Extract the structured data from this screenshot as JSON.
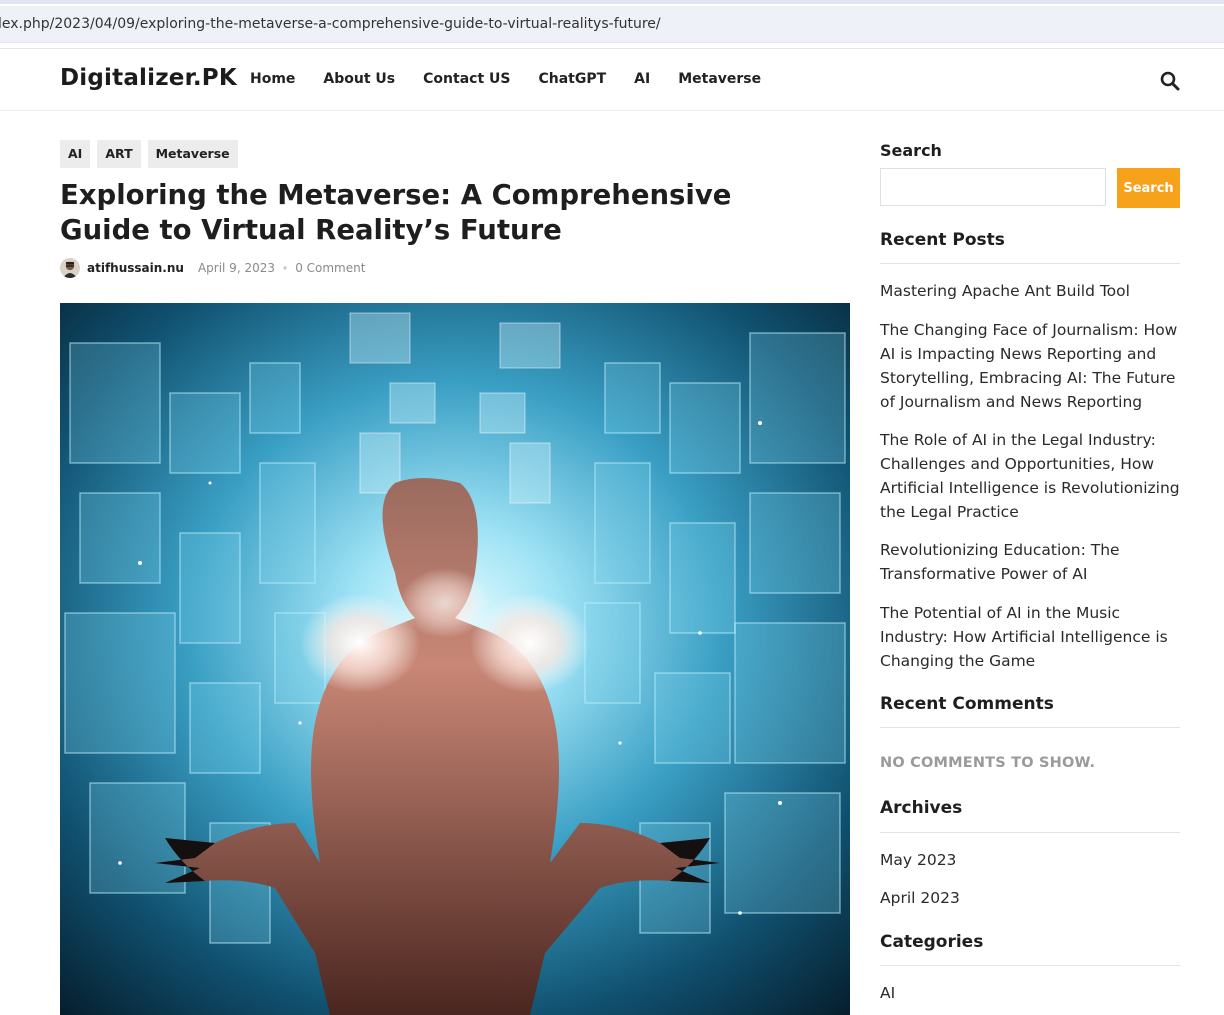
{
  "browser": {
    "url": "lex.php/2023/04/09/exploring-the-metaverse-a-comprehensive-guide-to-virtual-realitys-future/"
  },
  "header": {
    "brand": "Digitalizer.PK",
    "nav": [
      "Home",
      "About Us",
      "Contact US",
      "ChatGPT",
      "AI",
      "Metaverse"
    ],
    "search_icon": "search-icon"
  },
  "post": {
    "tags": [
      "AI",
      "ART",
      "Metaverse"
    ],
    "title": "Exploring the Metaverse: A Comprehensive Guide to Virtual Reality’s Future",
    "author": "atifhussain.nu",
    "date": "April 9, 2023",
    "comments": "0 Comment"
  },
  "sidebar": {
    "search": {
      "label": "Search",
      "button": "Search",
      "placeholder": ""
    },
    "recent_posts": {
      "title": "Recent Posts",
      "items": [
        "Mastering Apache Ant Build Tool",
        "The Changing Face of Journalism: How AI is Impacting News Reporting and Storytelling, Embracing AI: The Future of Journalism and News Reporting",
        "The Role of AI in the Legal Industry: Challenges and Opportunities, How Artificial Intelligence is Revolutionizing the Legal Practice",
        "Revolutionizing Education: The Transformative Power of AI",
        "The Potential of AI in the Music Industry: How Artificial Intelligence is Changing the Game"
      ]
    },
    "recent_comments": {
      "title": "Recent Comments",
      "empty": "NO COMMENTS TO SHOW."
    },
    "archives": {
      "title": "Archives",
      "items": [
        "May 2023",
        "April 2023"
      ]
    },
    "categories": {
      "title": "Categories",
      "items": [
        "AI"
      ]
    }
  },
  "colors": {
    "accent": "#f7a21b",
    "text": "#1e1e1e",
    "muted": "#8a8a8a"
  }
}
